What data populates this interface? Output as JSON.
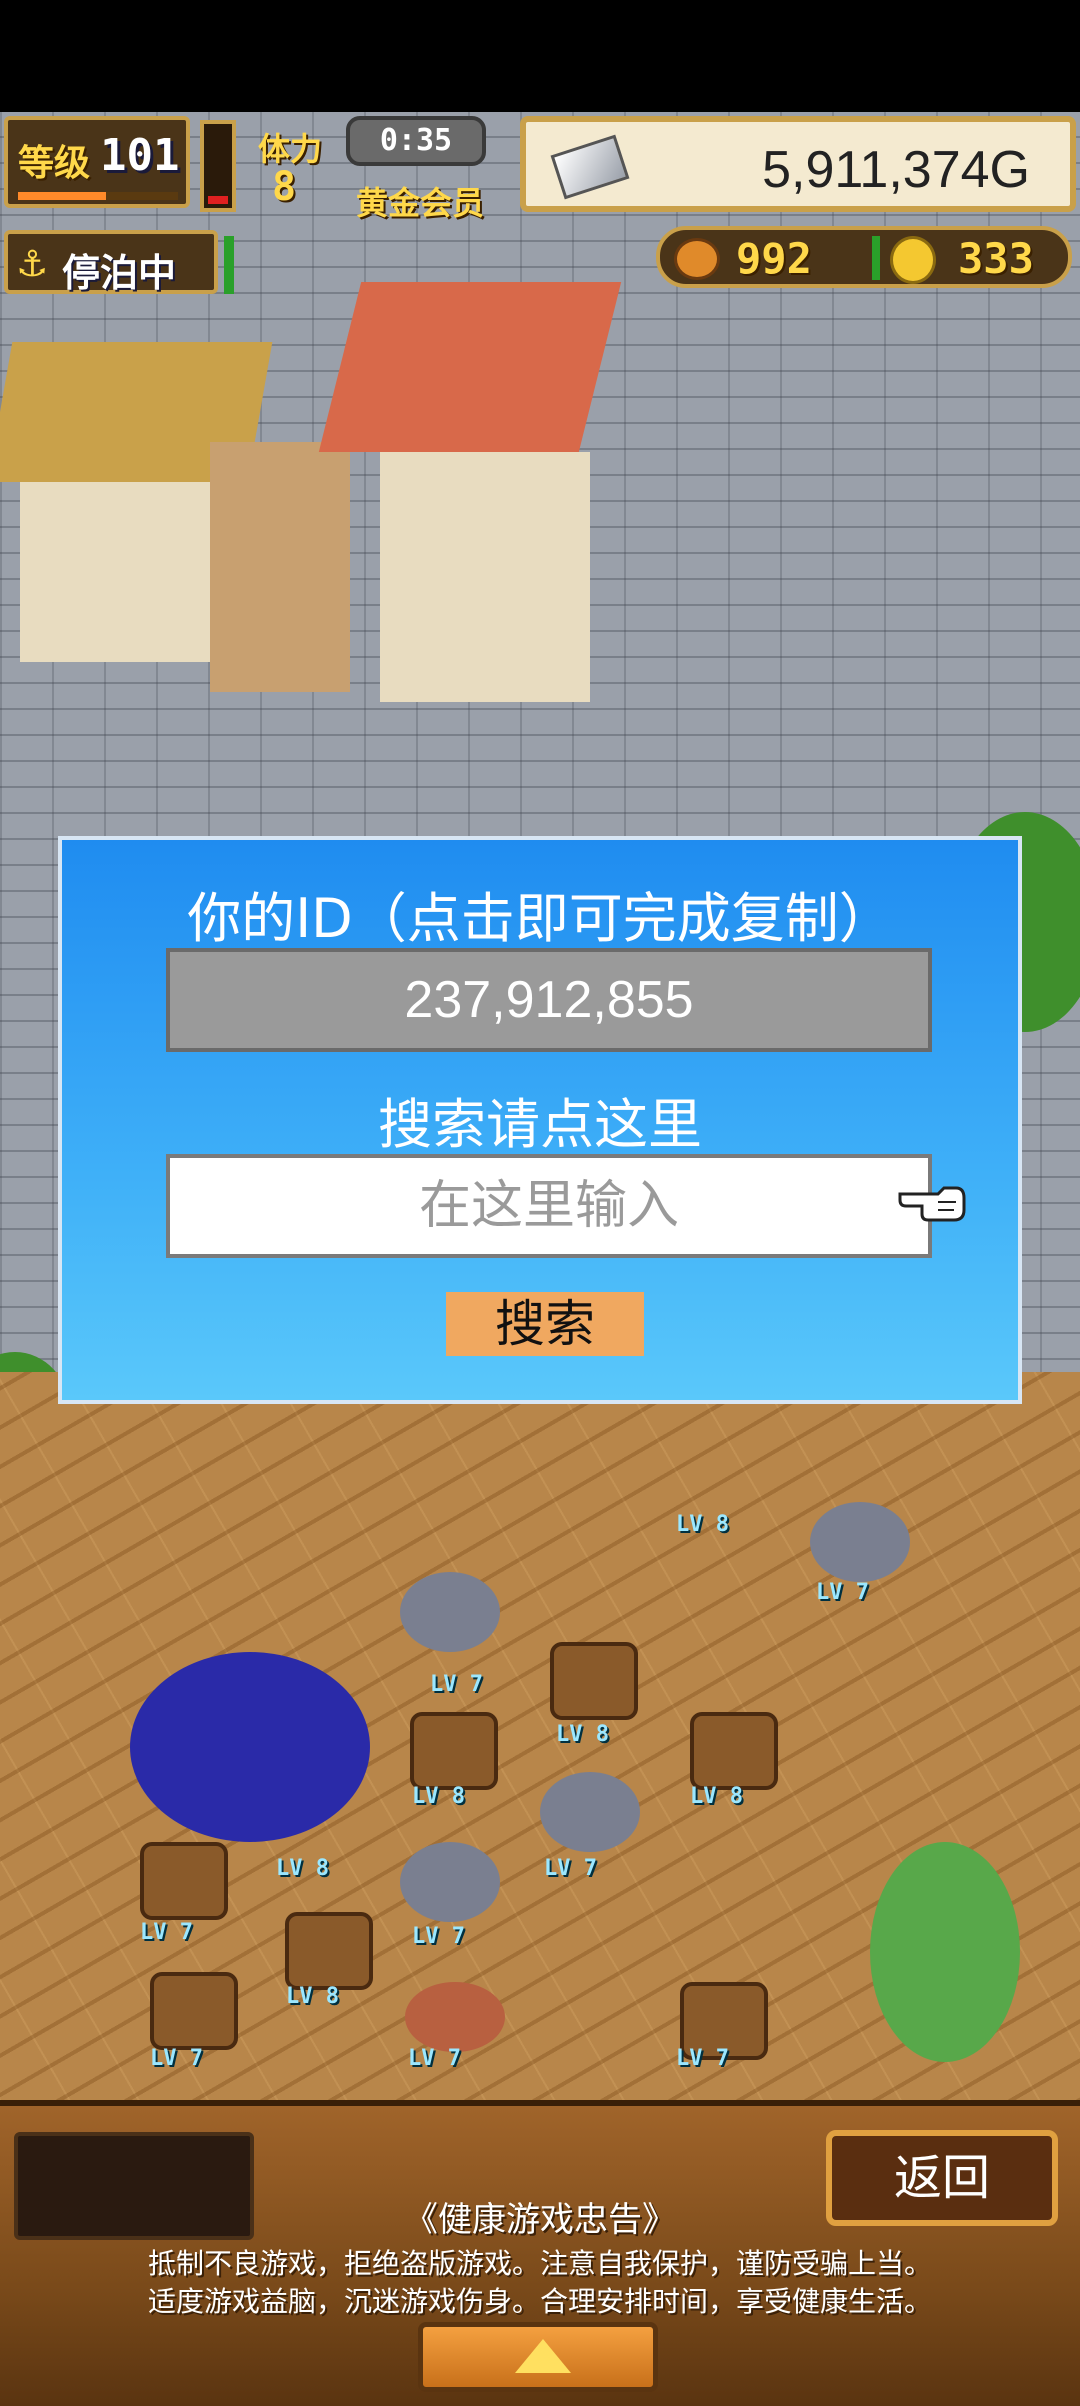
{
  "hud": {
    "level_label": "等级",
    "level_value": "101",
    "exp_fraction": 0.55,
    "stamina_gauge_fraction": 0.1,
    "stamina_label": "体力",
    "stamina_value": "8",
    "timer": "0:35",
    "vip_label": "黄金会员",
    "gold": "5,911,374G",
    "dock_status": "停泊中",
    "food": "992",
    "coins": "333"
  },
  "dialog": {
    "title": "你的ID（点击即可完成复制）",
    "player_id": "237,912,855",
    "search_label": "搜索请点这里",
    "search_placeholder": "在这里输入",
    "search_button": "搜索"
  },
  "bottom": {
    "back_button": "返回",
    "notice_title": "《健康游戏忠告》",
    "notice_line1": "抵制不良游戏，拒绝盗版游戏。注意自我保护，谨防受骗上当。",
    "notice_line2": "适度游戏益脑，沉迷游戏伤身。合理安排时间，享受健康生活。"
  },
  "level_tags": [
    "LV 7",
    "LV 8",
    "LV 7",
    "LV 8",
    "LV 8",
    "LV 8",
    "LV 7",
    "LV 8",
    "LV 7",
    "LV 7",
    "LV 8",
    "LV 7",
    "LV 7",
    "LV 7"
  ],
  "colors": {
    "dialog_top": "#1f8cf0",
    "dialog_bottom": "#5ac8fa",
    "search_button": "#f0a860",
    "hud_gold_text": "#ffd84a"
  }
}
